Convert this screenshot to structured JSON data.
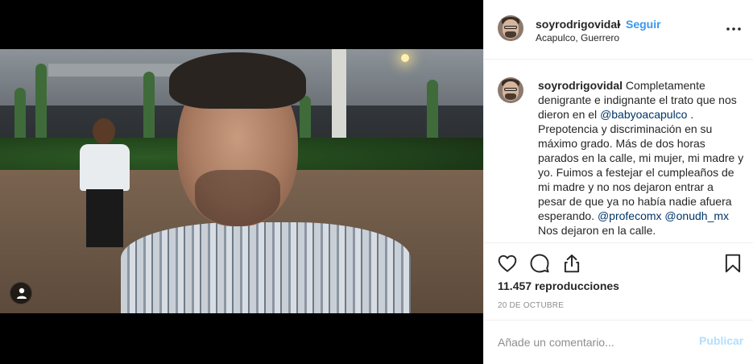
{
  "post": {
    "username": "soyrodrigovidal",
    "separator": "•",
    "follow_label": "Seguir",
    "location": "Acapulco, Guerrero",
    "more_icon": "more-options-icon"
  },
  "caption": {
    "username": "soyrodrigovidal",
    "text_1": " Completamente denigrante e indignante el trato que nos dieron en el ",
    "mention_1": "@babyoacapulco",
    "text_2": " . Prepotencia y discriminación en su máximo grado. Más de dos horas parados en la calle, mi mujer, mi madre y yo. Fuimos a festejar el cumpleaños de mi madre y no nos dejaron entrar a pesar de que ya no había nadie afuera esperando. ",
    "mention_2": "@profecomx",
    "text_3": " ",
    "mention_3": "@onudh_mx",
    "text_4": " Nos dejaron en la calle."
  },
  "stats": {
    "views": "11.457 reproducciones",
    "date": "20 DE OCTUBRE"
  },
  "comment": {
    "placeholder": "Añade un comentario...",
    "publish_label": "Publicar"
  },
  "colors": {
    "accent": "#3897f0",
    "publish_disabled": "#b2dffc",
    "mention": "#003569",
    "muted": "#8e8e8e",
    "border": "#efefef"
  },
  "icons": {
    "like": "heart-icon",
    "comment": "comment-bubble-icon",
    "share": "share-icon",
    "save": "bookmark-icon",
    "media_user": "user-tag-icon"
  }
}
